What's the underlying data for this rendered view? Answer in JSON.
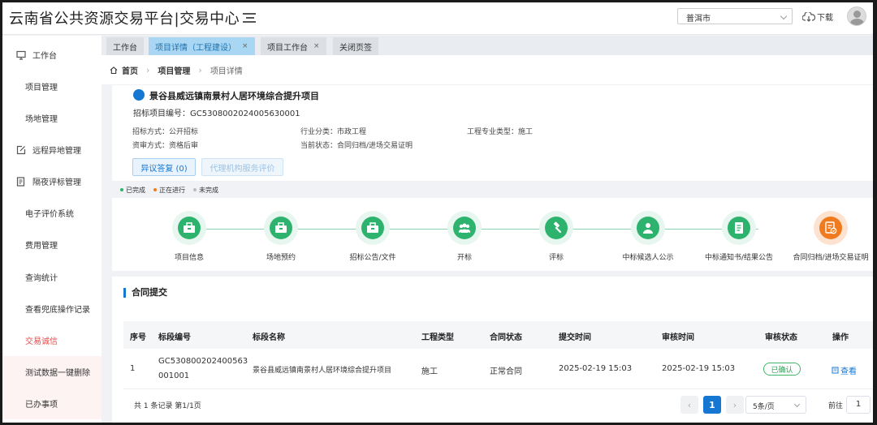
{
  "header": {
    "app_title": "云南省公共资源交易平台|交易中心",
    "city_select": "普洱市",
    "download_label": "下载"
  },
  "sidebar": {
    "items": [
      {
        "label": "工作台",
        "icon": "monitor-icon"
      },
      {
        "label": "项目管理"
      },
      {
        "label": "场地管理"
      },
      {
        "label": "远程异地管理",
        "icon": "edit-icon"
      },
      {
        "label": "隔夜评标管理",
        "icon": "document-icon"
      },
      {
        "label": "电子评价系统"
      },
      {
        "label": "费用管理"
      },
      {
        "label": "查询统计"
      },
      {
        "label": "查看兜底操作记录"
      },
      {
        "label": "交易诚信"
      },
      {
        "label": "测试数据一键删除"
      },
      {
        "label": "已办事项"
      }
    ]
  },
  "tabs": [
    {
      "label": "工作台"
    },
    {
      "label": "项目详情（工程建设）",
      "close": "×"
    },
    {
      "label": "项目工作台",
      "close": "×"
    },
    {
      "label": "关闭页签"
    }
  ],
  "breadcrumb": {
    "home": "首页",
    "level1": "项目管理",
    "current": "项目详情"
  },
  "project": {
    "name": "景谷县威远镇南景村人居环境综合提升项目",
    "number": "招标项目编号：GC5308002024005630001",
    "bid_method": "招标方式：公开招标",
    "industry": "行业分类：市政工程",
    "specialty": "工程专业类型：施工",
    "review_method": "资审方式：资格后审",
    "status": "当前状态：合同归档/进场交易证明",
    "objection_button": "异议答复 (0)",
    "agency_eval_button": "代理机构服务评价"
  },
  "legend": {
    "done": "已完成",
    "in_progress": "正在进行",
    "not_done": "未完成",
    "colors": {
      "done": "#2db36e",
      "in_progress": "#f07b1f",
      "not_done": "#bbbbbb"
    }
  },
  "process": {
    "steps": [
      {
        "label": "项目信息",
        "icon": "briefcase-icon",
        "state": "done"
      },
      {
        "label": "场地预约",
        "icon": "briefcase-icon",
        "state": "done"
      },
      {
        "label": "招标公告/文件",
        "icon": "briefcase-icon",
        "state": "done"
      },
      {
        "label": "开标",
        "icon": "group-icon",
        "state": "done"
      },
      {
        "label": "评标",
        "icon": "gavel-icon",
        "state": "done"
      },
      {
        "label": "中标候选人公示",
        "icon": "user-icon",
        "state": "done"
      },
      {
        "label": "中标通知书/结果公告",
        "icon": "notice-icon",
        "state": "done"
      },
      {
        "label": "合同归档/进场交易证明",
        "icon": "contract-icon",
        "state": "current"
      }
    ]
  },
  "contract": {
    "title": "合同提交",
    "columns": [
      "序号",
      "标段编号",
      "标段名称",
      "工程类型",
      "合同状态",
      "提交时间",
      "审核时间",
      "审核状态",
      "操作"
    ],
    "rows": [
      {
        "index": "1",
        "section_no_line1": "GC530800202400563",
        "section_no_line2": "001001",
        "section_name": "景谷县威远镇南景村人居环境综合提升项目",
        "type": "施工",
        "contract_status": "正常合同",
        "submit_time": "2025-02-19 15:03",
        "review_time": "2025-02-19 15:03",
        "review_status": "已确认",
        "action": "查看"
      }
    ],
    "pager": {
      "total": "共 1 条记录  第1/1页",
      "current_page": "1",
      "page_size": "5条/页",
      "goto_label": "前往",
      "goto_value": "1"
    }
  }
}
